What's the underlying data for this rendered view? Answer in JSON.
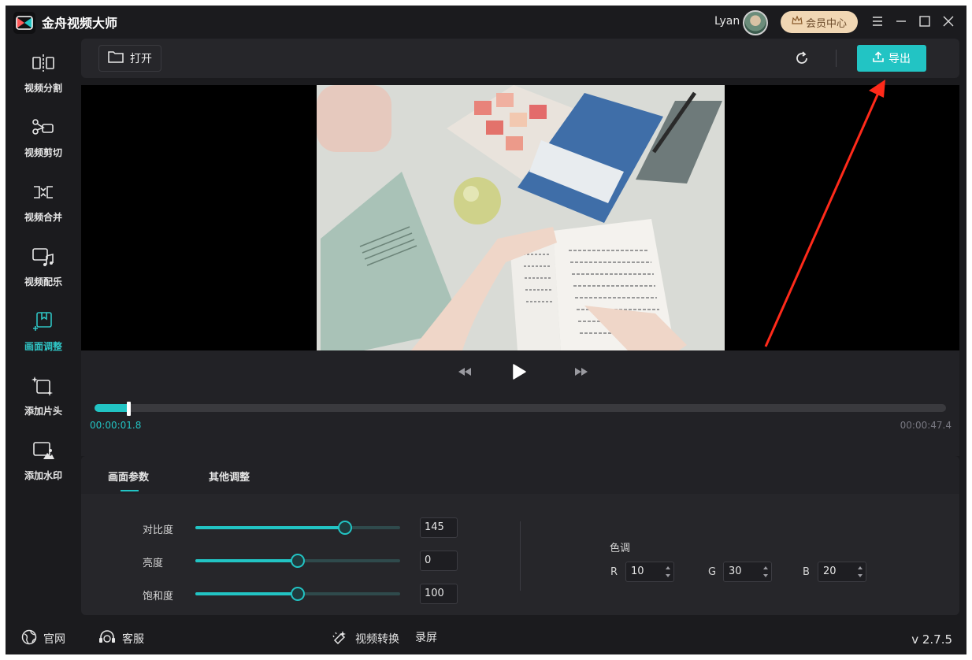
{
  "app": {
    "title": "金舟视频大师",
    "user_name": "Lyan",
    "vip_label": "会员中心"
  },
  "sidebar": {
    "items": [
      {
        "label": "视频分割",
        "icon": "split-icon"
      },
      {
        "label": "视频剪切",
        "icon": "scissors-icon"
      },
      {
        "label": "视频合并",
        "icon": "merge-icon"
      },
      {
        "label": "视频配乐",
        "icon": "music-icon"
      },
      {
        "label": "画面调整",
        "icon": "adjust-icon",
        "active": true
      },
      {
        "label": "添加片头",
        "icon": "intro-icon"
      },
      {
        "label": "添加水印",
        "icon": "watermark-icon"
      }
    ]
  },
  "toolbar": {
    "open_label": "打开",
    "export_label": "导出"
  },
  "player": {
    "current_time": "00:00:01.8",
    "total_time": "00:00:47.4",
    "progress_fraction": 0.038
  },
  "adjust": {
    "tabs": [
      {
        "label": "画面参数",
        "active": true
      },
      {
        "label": "其他调整",
        "active": false
      }
    ],
    "params": [
      {
        "label": "对比度",
        "value": "145",
        "fraction": 0.73
      },
      {
        "label": "亮度",
        "value": "0",
        "fraction": 0.5
      },
      {
        "label": "饱和度",
        "value": "100",
        "fraction": 0.5
      }
    ],
    "tone": {
      "title": "色调",
      "r_label": "R",
      "r_value": "10",
      "g_label": "G",
      "g_value": "30",
      "b_label": "B",
      "b_value": "20"
    }
  },
  "footer": {
    "website_label": "官网",
    "service_label": "客服",
    "convert_label": "视频转换",
    "record_label": "录屏",
    "version": "v 2.7.5"
  },
  "colors": {
    "accent": "#22c4c4",
    "background": "#1b1b1e",
    "annotation_arrow": "#ff2a1a"
  }
}
